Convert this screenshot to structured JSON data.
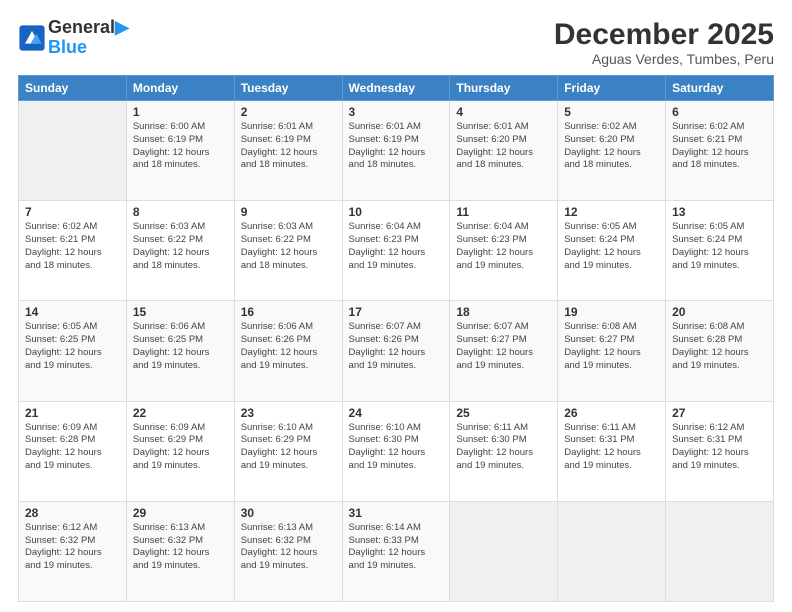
{
  "logo": {
    "line1": "General",
    "line2": "Blue"
  },
  "title": "December 2025",
  "location": "Aguas Verdes, Tumbes, Peru",
  "days_of_week": [
    "Sunday",
    "Monday",
    "Tuesday",
    "Wednesday",
    "Thursday",
    "Friday",
    "Saturday"
  ],
  "weeks": [
    [
      {
        "num": "",
        "empty": true
      },
      {
        "num": "1",
        "sunrise": "6:00 AM",
        "sunset": "6:19 PM",
        "daylight": "12 hours and 18 minutes."
      },
      {
        "num": "2",
        "sunrise": "6:01 AM",
        "sunset": "6:19 PM",
        "daylight": "12 hours and 18 minutes."
      },
      {
        "num": "3",
        "sunrise": "6:01 AM",
        "sunset": "6:19 PM",
        "daylight": "12 hours and 18 minutes."
      },
      {
        "num": "4",
        "sunrise": "6:01 AM",
        "sunset": "6:20 PM",
        "daylight": "12 hours and 18 minutes."
      },
      {
        "num": "5",
        "sunrise": "6:02 AM",
        "sunset": "6:20 PM",
        "daylight": "12 hours and 18 minutes."
      },
      {
        "num": "6",
        "sunrise": "6:02 AM",
        "sunset": "6:21 PM",
        "daylight": "12 hours and 18 minutes."
      }
    ],
    [
      {
        "num": "7",
        "sunrise": "6:02 AM",
        "sunset": "6:21 PM",
        "daylight": "12 hours and 18 minutes."
      },
      {
        "num": "8",
        "sunrise": "6:03 AM",
        "sunset": "6:22 PM",
        "daylight": "12 hours and 18 minutes."
      },
      {
        "num": "9",
        "sunrise": "6:03 AM",
        "sunset": "6:22 PM",
        "daylight": "12 hours and 18 minutes."
      },
      {
        "num": "10",
        "sunrise": "6:04 AM",
        "sunset": "6:23 PM",
        "daylight": "12 hours and 19 minutes."
      },
      {
        "num": "11",
        "sunrise": "6:04 AM",
        "sunset": "6:23 PM",
        "daylight": "12 hours and 19 minutes."
      },
      {
        "num": "12",
        "sunrise": "6:05 AM",
        "sunset": "6:24 PM",
        "daylight": "12 hours and 19 minutes."
      },
      {
        "num": "13",
        "sunrise": "6:05 AM",
        "sunset": "6:24 PM",
        "daylight": "12 hours and 19 minutes."
      }
    ],
    [
      {
        "num": "14",
        "sunrise": "6:05 AM",
        "sunset": "6:25 PM",
        "daylight": "12 hours and 19 minutes."
      },
      {
        "num": "15",
        "sunrise": "6:06 AM",
        "sunset": "6:25 PM",
        "daylight": "12 hours and 19 minutes."
      },
      {
        "num": "16",
        "sunrise": "6:06 AM",
        "sunset": "6:26 PM",
        "daylight": "12 hours and 19 minutes."
      },
      {
        "num": "17",
        "sunrise": "6:07 AM",
        "sunset": "6:26 PM",
        "daylight": "12 hours and 19 minutes."
      },
      {
        "num": "18",
        "sunrise": "6:07 AM",
        "sunset": "6:27 PM",
        "daylight": "12 hours and 19 minutes."
      },
      {
        "num": "19",
        "sunrise": "6:08 AM",
        "sunset": "6:27 PM",
        "daylight": "12 hours and 19 minutes."
      },
      {
        "num": "20",
        "sunrise": "6:08 AM",
        "sunset": "6:28 PM",
        "daylight": "12 hours and 19 minutes."
      }
    ],
    [
      {
        "num": "21",
        "sunrise": "6:09 AM",
        "sunset": "6:28 PM",
        "daylight": "12 hours and 19 minutes."
      },
      {
        "num": "22",
        "sunrise": "6:09 AM",
        "sunset": "6:29 PM",
        "daylight": "12 hours and 19 minutes."
      },
      {
        "num": "23",
        "sunrise": "6:10 AM",
        "sunset": "6:29 PM",
        "daylight": "12 hours and 19 minutes."
      },
      {
        "num": "24",
        "sunrise": "6:10 AM",
        "sunset": "6:30 PM",
        "daylight": "12 hours and 19 minutes."
      },
      {
        "num": "25",
        "sunrise": "6:11 AM",
        "sunset": "6:30 PM",
        "daylight": "12 hours and 19 minutes."
      },
      {
        "num": "26",
        "sunrise": "6:11 AM",
        "sunset": "6:31 PM",
        "daylight": "12 hours and 19 minutes."
      },
      {
        "num": "27",
        "sunrise": "6:12 AM",
        "sunset": "6:31 PM",
        "daylight": "12 hours and 19 minutes."
      }
    ],
    [
      {
        "num": "28",
        "sunrise": "6:12 AM",
        "sunset": "6:32 PM",
        "daylight": "12 hours and 19 minutes."
      },
      {
        "num": "29",
        "sunrise": "6:13 AM",
        "sunset": "6:32 PM",
        "daylight": "12 hours and 19 minutes."
      },
      {
        "num": "30",
        "sunrise": "6:13 AM",
        "sunset": "6:32 PM",
        "daylight": "12 hours and 19 minutes."
      },
      {
        "num": "31",
        "sunrise": "6:14 AM",
        "sunset": "6:33 PM",
        "daylight": "12 hours and 19 minutes."
      },
      {
        "num": "",
        "empty": true
      },
      {
        "num": "",
        "empty": true
      },
      {
        "num": "",
        "empty": true
      }
    ]
  ]
}
